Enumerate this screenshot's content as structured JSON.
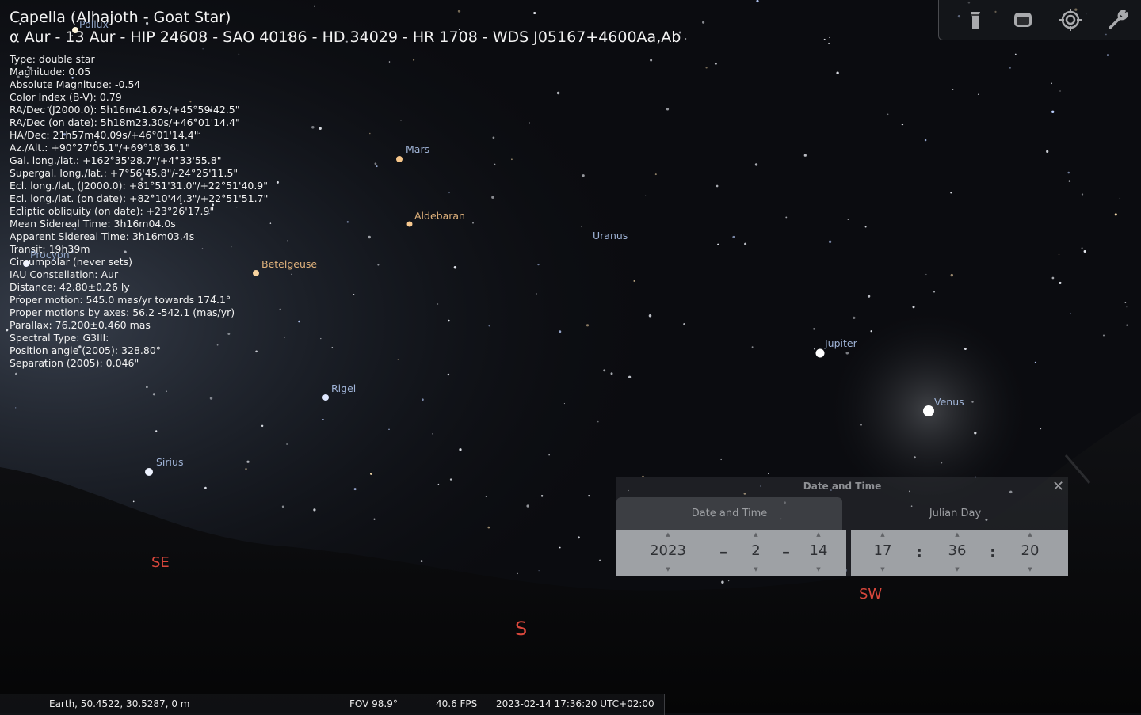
{
  "object": {
    "title": "Capella (Alhajoth - Goat Star)",
    "designations": "α Aur - 13 Aur - HIP 24608 - SAO 40186 - HD 34029 - HR 1708 - WDS J05167+4600Aa,Ab",
    "lines": [
      "Type: double star",
      "Magnitude: 0.05",
      "Absolute Magnitude: -0.54",
      "Color Index (B-V): 0.79",
      "RA/Dec (J2000.0): 5h16m41.67s/+45°59'42.5\"",
      "RA/Dec (on date): 5h18m23.30s/+46°01'14.4\"",
      "HA/Dec: 21h57m40.09s/+46°01'14.4\"",
      "Az./Alt.: +90°27'05.1\"/+69°18'36.1\"",
      "Gal. long./lat.: +162°35'28.7\"/+4°33'55.8\"",
      "Supergal. long./lat.: +7°56'45.8\"/-24°25'11.5\"",
      "Ecl. long./lat. (J2000.0): +81°51'31.0\"/+22°51'40.9\"",
      "Ecl. long./lat. (on date): +82°10'44.3\"/+22°51'51.7\"",
      "Ecliptic obliquity (on date): +23°26'17.9\"",
      "Mean Sidereal Time: 3h16m04.0s",
      "Apparent Sidereal Time: 3h16m03.4s",
      "Transit: 19h39m",
      "Circumpolar (never sets)",
      "IAU Constellation: Aur",
      "Distance: 42.80±0.26 ly",
      "Proper motion: 545.0 mas/yr towards 174.1°",
      "Proper motions by axes: 56.2 -542.1 (mas/yr)",
      "Parallax: 76.200±0.460 mas",
      "Spectral Type: G3III:",
      "Position angle (2005): 328.80°",
      "Separation (2005): 0.046\""
    ]
  },
  "sky_labels": {
    "pollux": "Pollux",
    "procyon": "Procyon",
    "mars": "Mars",
    "aldebaran": "Aldebaran",
    "uranus": "Uranus",
    "betelgeuse": "Betelgeuse",
    "rigel": "Rigel",
    "jupiter": "Jupiter",
    "venus": "Venus",
    "sirius": "Sirius"
  },
  "compass": {
    "se": "SE",
    "s": "S",
    "sw": "SW"
  },
  "toolbar": {
    "icons": [
      "flashlight-icon",
      "window-icon",
      "target-icon",
      "wrench-icon"
    ]
  },
  "dialog": {
    "title": "Date and Time",
    "close": "✕",
    "tabs": [
      "Date and Time",
      "Julian Day"
    ],
    "year": "2023",
    "month": "2",
    "day": "14",
    "hour": "17",
    "minute": "36",
    "second": "20",
    "date_sep": "–",
    "time_sep": ":"
  },
  "status": {
    "location": "Earth, 50.4522, 30.5287, 0 m",
    "fov": "FOV 98.9°",
    "fps": "40.6 FPS",
    "datetime": "2023-02-14 17:36:20 UTC+02:00"
  },
  "colors": {
    "sky": "#0b0c10",
    "compass": "#d9473c",
    "label_blue": "#9fb3d6",
    "label_orange": "#e0b27c"
  }
}
